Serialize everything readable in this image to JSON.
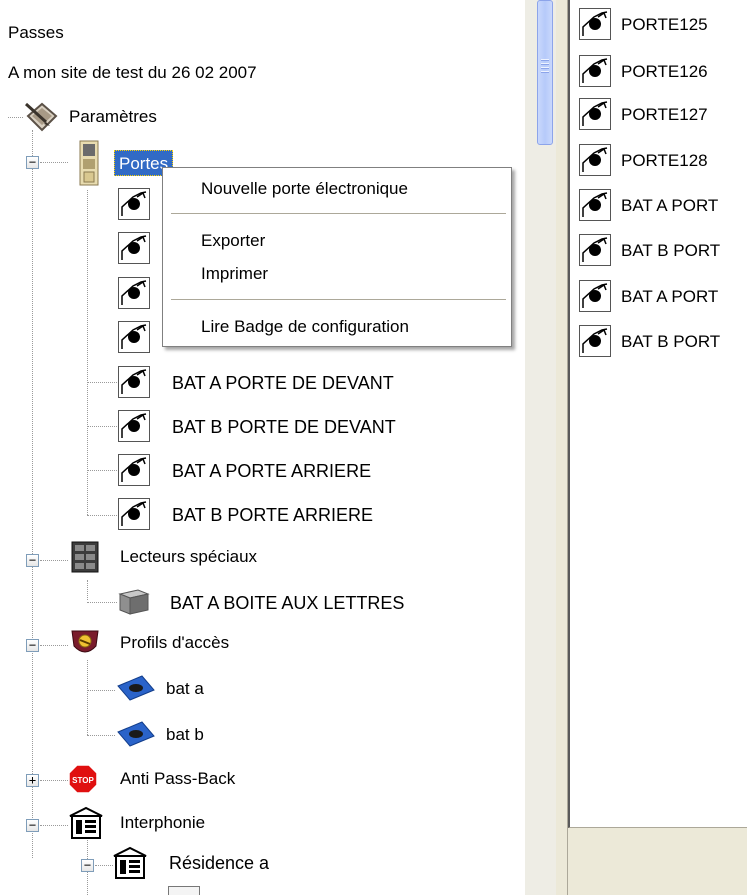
{
  "tree": {
    "root_label": "Passes",
    "site_label": "A mon site de test du 26 02 2007",
    "params_label": "Paramètres",
    "portes_label": "Portes",
    "doors": [
      "BAT A PORTE DE DEVANT",
      "BAT B PORTE DE DEVANT",
      "BAT A PORTE ARRIERE",
      "BAT B PORTE ARRIERE"
    ],
    "lecteurs_label": "Lecteurs spéciaux",
    "lecteurs_items": [
      "BAT A BOITE AUX LETTRES"
    ],
    "profils_label": "Profils d'accès",
    "profils_items": [
      "bat a",
      "bat b"
    ],
    "antipass_label": "Anti Pass-Back",
    "interphonie_label": "Interphonie",
    "residence_label": "Résidence a",
    "expander_minus": "−",
    "expander_plus": "+"
  },
  "right_list": {
    "items": [
      "PORTE125",
      "PORTE126",
      "PORTE127",
      "PORTE128",
      "BAT A PORT",
      "BAT B PORT",
      "BAT A PORT",
      "BAT B PORT"
    ]
  },
  "context_menu": {
    "new_door": "Nouvelle porte électronique",
    "export": "Exporter",
    "print": "Imprimer",
    "read_badge": "Lire Badge de configuration"
  },
  "colors": {
    "selection": "#316ac5",
    "stop_red": "#e01010",
    "window_bg": "#ece9d8"
  },
  "icons": {
    "params": "settings-pen-icon",
    "portes": "door-panel-icon",
    "door": "electronic-door-icon",
    "lecteurs": "reader-cabinet-icon",
    "lecteur_item": "reader-box-icon",
    "profils": "access-profile-icon",
    "profil_item": "profile-card-icon",
    "antipass": "stop-sign-icon",
    "interphonie": "intercom-icon"
  }
}
